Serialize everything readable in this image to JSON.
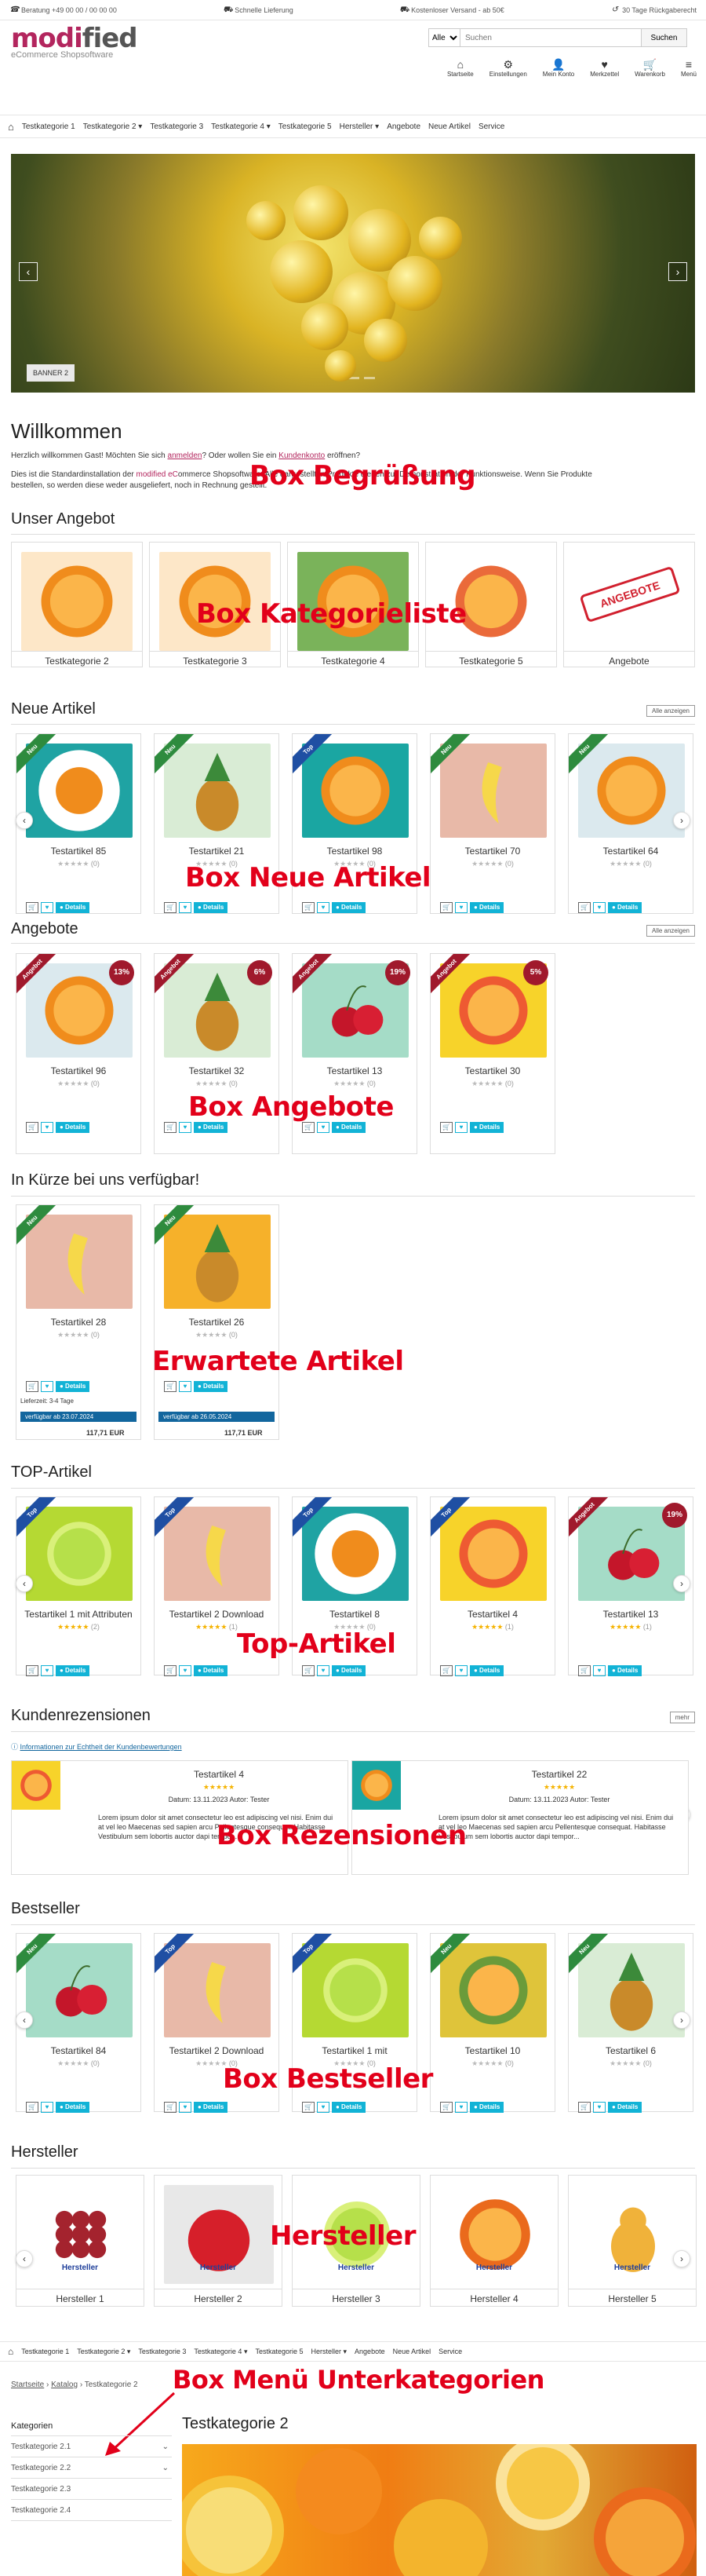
{
  "topbar": {
    "hotline": "Beratung +49 00 00 / 00 00 00",
    "shipping": "Schnelle Lieferung",
    "free": "Kostenloser Versand - ab 50€",
    "returns": "30 Tage Rückgaberecht"
  },
  "logo": {
    "brand_a": "modi",
    "brand_b": "fied",
    "tagline": "eCommerce Shopsoftware"
  },
  "search": {
    "category": "Alle",
    "placeholder": "Suchen",
    "button": "Suchen"
  },
  "navicons": [
    {
      "icon": "home-icon",
      "glyph": "⌂",
      "label": "Startseite"
    },
    {
      "icon": "gear-icon",
      "glyph": "⚙",
      "label": "Einstellungen"
    },
    {
      "icon": "user-icon",
      "glyph": "👤",
      "label": "Mein Konto"
    },
    {
      "icon": "heart-icon",
      "glyph": "♥",
      "label": "Merkzettel"
    },
    {
      "icon": "cart-icon",
      "glyph": "🛒",
      "label": "Warenkorb"
    },
    {
      "icon": "menu-icon",
      "glyph": "≡",
      "label": "Menü"
    }
  ],
  "menu": [
    "Testkategorie 1",
    "Testkategorie 2 ▾",
    "Testkategorie 3",
    "Testkategorie 4 ▾",
    "Testkategorie 5",
    "Hersteller ▾",
    "Angebote",
    "Neue Artikel",
    "Service"
  ],
  "hero": {
    "badge": "BANNER 2"
  },
  "welcome": {
    "title": "Willkommen",
    "line1_a": "Herzlich willkommen Gast! Möchten Sie sich ",
    "login": "anmelden",
    "line1_b": "? Oder wollen Sie ein ",
    "register": "Kundenkonto",
    "line1_c": " eröffnen?",
    "line2_a": "Dies ist die Standardinstallation der ",
    "brand": "modified eC",
    "line2_b": "ommerce Shopsoftware. Alle dargestellten Produkte dienen zur Demonstration der Funktionsweise. Wenn Sie Produkte",
    "line3": "bestellen, so werden diese weder ausgeliefert, noch in Rechnung gestellt."
  },
  "labels": {
    "welcome": "Box Begrüßung",
    "categories": "Box Kategorieliste",
    "new": "Box Neue Artikel",
    "offers": "Box Angebote",
    "upcoming": "Erwartete Artikel",
    "top": "Top-Artikel",
    "reviews": "Box Rezensionen",
    "best": "Box Bestseller",
    "makers": "Hersteller",
    "submenu": "Box Menü Unterkategorien"
  },
  "sections": {
    "offer": "Unser Angebot",
    "new": "Neue Artikel",
    "offers": "Angebote",
    "upcoming": "In Kürze bei uns verfügbar!",
    "top": "TOP-Artikel",
    "reviews": "Kundenrezensionen",
    "best": "Bestseller",
    "makers": "Hersteller",
    "more": "Alle anzeigen",
    "more2": "mehr"
  },
  "categories": [
    "Testkategorie 2",
    "Testkategorie 3",
    "Testkategorie 4",
    "Testkategorie 5",
    "Angebote"
  ],
  "angebote_stamp": "ANGEBOTE",
  "new_items": [
    {
      "name": "Testartikel 85",
      "rib": "Neu"
    },
    {
      "name": "Testartikel 21",
      "rib": "Neu"
    },
    {
      "name": "Testartikel 98",
      "rib": "Top"
    },
    {
      "name": "Testartikel 70",
      "rib": "Neu"
    },
    {
      "name": "Testartikel 64",
      "rib": "Neu"
    }
  ],
  "offer_items": [
    {
      "name": "Testartikel 96",
      "pct": "13%"
    },
    {
      "name": "Testartikel 32",
      "pct": "6%"
    },
    {
      "name": "Testartikel 13",
      "pct": "19%"
    },
    {
      "name": "Testartikel 30",
      "pct": "5%"
    }
  ],
  "upcoming_items": [
    {
      "name": "Testartikel 28",
      "delivery": "Lieferzeit: 3-4 Tage",
      "avail": "verfügbar ab 23.07.2024",
      "price": "117,71 EUR"
    },
    {
      "name": "Testartikel 26",
      "delivery": "",
      "avail": "verfügbar ab 26.05.2024",
      "price": "117,71 EUR"
    }
  ],
  "top_items": [
    {
      "name": "Testartikel 1 mit Attributen",
      "rib": "Top",
      "rating": "(2)"
    },
    {
      "name": "Testartikel 2 Download",
      "rib": "Top",
      "rating": "(1)"
    },
    {
      "name": "Testartikel 8",
      "rib": "Top",
      "rating": "(0)"
    },
    {
      "name": "Testartikel 4",
      "rib": "Top",
      "rating": "(1)"
    },
    {
      "name": "Testartikel 13",
      "rib": "Angebot",
      "rating": "(1)"
    }
  ],
  "reviews": {
    "info": "Informationen zur Echtheit der Kundenbewertungen",
    "items": [
      {
        "title": "Testartikel 4",
        "meta": "Datum: 13.11.2023  Autor: Tester",
        "text": "Lorem ipsum dolor sit amet consectetur leo est adipiscing vel nisi. Enim dui at vel leo Maecenas sed sapien arcu Pellentesque consequat. Habitasse Vestibulum sem lobortis auctor dapi tempor..."
      },
      {
        "title": "Testartikel 22",
        "meta": "Datum: 13.11.2023  Autor: Tester",
        "text": "Lorem ipsum dolor sit amet consectetur leo est adipiscing vel nisi. Enim dui at vel leo Maecenas sed sapien arcu Pellentesque consequat. Habitasse Vestibulum sem lobortis auctor dapi tempor..."
      }
    ]
  },
  "best_items": [
    {
      "name": "Testartikel 84",
      "rib": "Neu"
    },
    {
      "name": "Testartikel 2 Download",
      "rib": "Top"
    },
    {
      "name": "Testartikel 1 mit",
      "rib": "Top"
    },
    {
      "name": "Testartikel 10",
      "rib": "Neu"
    },
    {
      "name": "Testartikel 6",
      "rib": "Neu"
    }
  ],
  "makers": [
    {
      "name": "Hersteller 1",
      "badge": "Hersteller"
    },
    {
      "name": "Hersteller 2",
      "badge": "Hersteller"
    },
    {
      "name": "Hersteller 3",
      "badge": "Hersteller"
    },
    {
      "name": "Hersteller 4",
      "badge": "Hersteller"
    },
    {
      "name": "Hersteller 5",
      "badge": "Hersteller"
    }
  ],
  "menu2": [
    "Testkategorie 1",
    "Testkategorie 2 ▾",
    "Testkategorie 3",
    "Testkategorie 4 ▾",
    "Testkategorie 5",
    "Hersteller ▾",
    "Angebote",
    "Neue Artikel",
    "Service"
  ],
  "breadcrumb": [
    "Startseite",
    "Katalog",
    "Testkategorie 2"
  ],
  "sidebar": {
    "title": "Kategorien",
    "items": [
      "Testkategorie 2.1",
      "Testkategorie 2.2",
      "Testkategorie 2.3",
      "Testkategorie 2.4"
    ]
  },
  "cat_title": "Testkategorie 2",
  "stars_empty": "★★★★★",
  "rating0": "(0)"
}
